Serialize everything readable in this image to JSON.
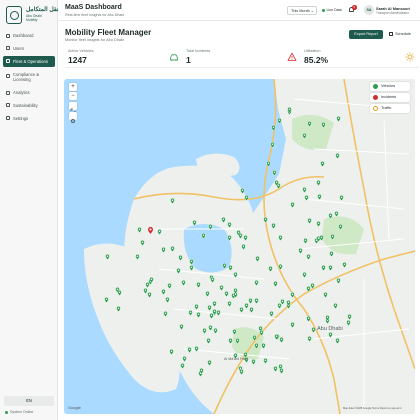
{
  "brand": {
    "logo_ar": "النقل المتكامل",
    "logo_en_line1": "Abu Dhabi",
    "logo_en_line2": "Mobility"
  },
  "sidebar": {
    "items": [
      {
        "label": "Dashboard",
        "active": false
      },
      {
        "label": "Users",
        "active": false
      },
      {
        "label": "Fleet & Operations",
        "active": true
      },
      {
        "label": "Compliance & Licensing",
        "active": false
      },
      {
        "label": "Analytics",
        "active": false
      },
      {
        "label": "Sustainability",
        "active": false
      },
      {
        "label": "Settings",
        "active": false
      }
    ],
    "language_label": "EN",
    "system_status": "System Online"
  },
  "header": {
    "title": "MaaS Dashboard",
    "subtitle": "Real-time fleet insights for Abu Dhabi",
    "period": "This Month",
    "live_label": "Live Data",
    "notification_count": "5",
    "user_initials": "SA",
    "user_name": "Sarah Al Mansoori",
    "user_role": "Transport Administrator"
  },
  "page": {
    "title": "Mobility Fleet Manager",
    "subtitle": "Monitor fleet insights for Abu Dhabi",
    "export_label": "Export Report",
    "schedule_label": "Schedule"
  },
  "stats": [
    {
      "label": "Active Vehicles",
      "value": "1247",
      "icon": "car-icon",
      "color": "#2e9e4f"
    },
    {
      "label": "Total Incidents",
      "value": "1",
      "icon": "warning-icon",
      "color": "#d42c2c"
    },
    {
      "label": "Utilization",
      "value": "85.2%",
      "icon": "sun-icon",
      "color": "#e0a21b"
    }
  ],
  "map": {
    "layers": [
      {
        "label": "Vehicles",
        "icon": "vehicle-icon",
        "color": "#2e9e4f"
      },
      {
        "label": "Incidents",
        "icon": "incident-icon",
        "color": "#d42c2c"
      },
      {
        "label": "Traffic",
        "icon": "traffic-icon",
        "color": "#e0a21b"
      }
    ],
    "place_label": "Abu Dhabi",
    "district_label": "Al Ma'ard Park",
    "provider": "Google",
    "attribution": "Map data ©2025 Google  Terms  Report a map error",
    "marker_color": "#2e9e4f",
    "incident_color": "#d42c2c"
  },
  "colors": {
    "brand": "#1f5a4e",
    "water": "#aadaff",
    "land": "#eef0ee",
    "park": "#cfe8c6"
  }
}
